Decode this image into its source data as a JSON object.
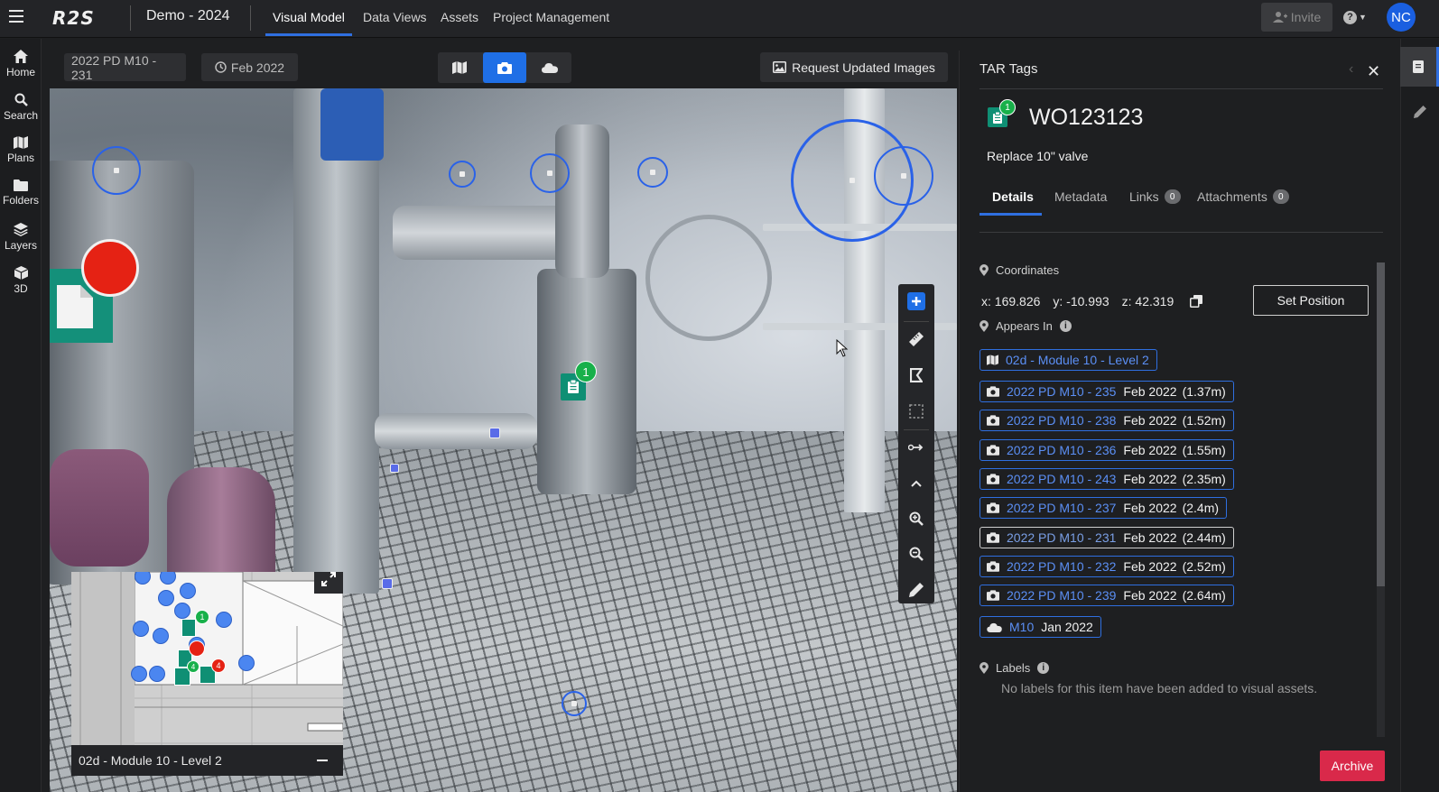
{
  "header": {
    "logo": "R2S",
    "project": "Demo - 2024",
    "tabs": [
      {
        "label": "Visual Model",
        "active": true
      },
      {
        "label": "Data Views",
        "active": false
      },
      {
        "label": "Assets",
        "active": false
      },
      {
        "label": "Project Management",
        "active": false
      }
    ],
    "invite_label": "Invite",
    "help_icon": "question-icon",
    "avatar_initials": "NC"
  },
  "sidebar": {
    "items": [
      {
        "label": "Home",
        "icon": "home-icon"
      },
      {
        "label": "Search",
        "icon": "search-icon"
      },
      {
        "label": "Plans",
        "icon": "map-icon"
      },
      {
        "label": "Folders",
        "icon": "folder-icon"
      },
      {
        "label": "Layers",
        "icon": "layers-icon"
      },
      {
        "label": "3D",
        "icon": "cube-icon"
      }
    ]
  },
  "viewer": {
    "image_name": "2022 PD M10 - 231",
    "date": "Feb 2022",
    "modes": [
      "map-icon",
      "camera-icon",
      "cloud-icon"
    ],
    "active_mode": "camera-icon",
    "request_label": "Request Updated Images",
    "marker_count": "1",
    "minimap": {
      "title": "02d - Module 10 - Level 2",
      "badges": [
        "1",
        "4",
        "4"
      ]
    },
    "tools": [
      "add-icon",
      "ruler-icon",
      "crop-icon",
      "select-icon",
      "measure-link-icon",
      "chevron-up-icon",
      "zoom-in-icon",
      "zoom-out-icon",
      "pencil-icon"
    ]
  },
  "panel": {
    "title": "TAR Tags",
    "work_order": {
      "id": "WO123123",
      "badge": "1",
      "description": "Replace 10\" valve"
    },
    "tabs": [
      {
        "label": "Details",
        "active": true
      },
      {
        "label": "Metadata",
        "active": false
      },
      {
        "label": "Links",
        "count": "0"
      },
      {
        "label": "Attachments",
        "count": "0"
      }
    ],
    "coordinates": {
      "label": "Coordinates",
      "x": "x: 169.826",
      "y": "y: -10.993",
      "z": "z: 42.319",
      "set_position_label": "Set Position"
    },
    "appears_in": {
      "label": "Appears In",
      "plan": {
        "name": "02d - Module 10 - Level 2"
      },
      "images": [
        {
          "name": "2022 PD M10 - 235",
          "date": "Feb 2022",
          "distance": "(1.37m)"
        },
        {
          "name": "2022 PD M10 - 238",
          "date": "Feb 2022",
          "distance": "(1.52m)"
        },
        {
          "name": "2022 PD M10 - 236",
          "date": "Feb 2022",
          "distance": "(1.55m)"
        },
        {
          "name": "2022 PD M10 - 243",
          "date": "Feb 2022",
          "distance": "(2.35m)"
        },
        {
          "name": "2022 PD M10 - 237",
          "date": "Feb 2022",
          "distance": "(2.4m)"
        },
        {
          "name": "2022 PD M10 - 231",
          "date": "Feb 2022",
          "distance": "(2.44m)",
          "current": true
        },
        {
          "name": "2022 PD M10 - 232",
          "date": "Feb 2022",
          "distance": "(2.52m)"
        },
        {
          "name": "2022 PD M10 - 239",
          "date": "Feb 2022",
          "distance": "(2.64m)"
        }
      ],
      "cloud": {
        "name": "M10",
        "date": "Jan 2022"
      }
    },
    "labels": {
      "label": "Labels",
      "empty_text": "No labels for this item have been added to visual assets."
    },
    "archive_label": "Archive"
  },
  "rail": {
    "items": [
      "tag-doc-icon",
      "edit-icon"
    ]
  },
  "colors": {
    "accent": "#1f6fe6",
    "tag_green": "#0f8f74",
    "archive_red": "#d9294a",
    "marker_red": "#e52214"
  }
}
